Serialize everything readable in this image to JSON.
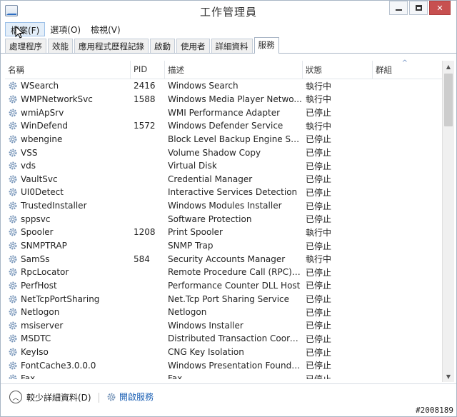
{
  "window": {
    "title": "工作管理員"
  },
  "menubar": {
    "items": [
      "檔案(F)",
      "選項(O)",
      "檢視(V)"
    ]
  },
  "tabs": [
    "處理程序",
    "效能",
    "應用程式歷程記錄",
    "啟動",
    "使用者",
    "詳細資料",
    "服務"
  ],
  "active_tab": 6,
  "table": {
    "columns": [
      "名稱",
      "PID",
      "描述",
      "狀態",
      "群組"
    ],
    "rows": [
      [
        "WSearch",
        "2416",
        "Windows Search",
        "執行中",
        ""
      ],
      [
        "WMPNetworkSvc",
        "1588",
        "Windows Media Player Netwo...",
        "執行中",
        ""
      ],
      [
        "wmiApSrv",
        "",
        "WMI Performance Adapter",
        "已停止",
        ""
      ],
      [
        "WinDefend",
        "1572",
        "Windows Defender Service",
        "執行中",
        ""
      ],
      [
        "wbengine",
        "",
        "Block Level Backup Engine Ser...",
        "已停止",
        ""
      ],
      [
        "VSS",
        "",
        "Volume Shadow Copy",
        "已停止",
        ""
      ],
      [
        "vds",
        "",
        "Virtual Disk",
        "已停止",
        ""
      ],
      [
        "VaultSvc",
        "",
        "Credential Manager",
        "已停止",
        ""
      ],
      [
        "UI0Detect",
        "",
        "Interactive Services Detection",
        "已停止",
        ""
      ],
      [
        "TrustedInstaller",
        "",
        "Windows Modules Installer",
        "已停止",
        ""
      ],
      [
        "sppsvc",
        "",
        "Software Protection",
        "已停止",
        ""
      ],
      [
        "Spooler",
        "1208",
        "Print Spooler",
        "執行中",
        ""
      ],
      [
        "SNMPTRAP",
        "",
        "SNMP Trap",
        "已停止",
        ""
      ],
      [
        "SamSs",
        "584",
        "Security Accounts Manager",
        "執行中",
        ""
      ],
      [
        "RpcLocator",
        "",
        "Remote Procedure Call (RPC) L...",
        "已停止",
        ""
      ],
      [
        "PerfHost",
        "",
        "Performance Counter DLL Host",
        "已停止",
        ""
      ],
      [
        "NetTcpPortSharing",
        "",
        "Net.Tcp Port Sharing Service",
        "已停止",
        ""
      ],
      [
        "Netlogon",
        "",
        "Netlogon",
        "已停止",
        ""
      ],
      [
        "msiserver",
        "",
        "Windows Installer",
        "已停止",
        ""
      ],
      [
        "MSDTC",
        "",
        "Distributed Transaction Coordi...",
        "已停止",
        ""
      ],
      [
        "KeyIso",
        "",
        "CNG Key Isolation",
        "已停止",
        ""
      ],
      [
        "FontCache3.0.0.0",
        "",
        "Windows Presentation Founda...",
        "已停止",
        ""
      ],
      [
        "Fax",
        "",
        "Fax",
        "已停止",
        ""
      ]
    ]
  },
  "footer": {
    "fewer_details": "較少詳細資料(D)",
    "open_services": "開啟服務"
  },
  "watermark": "#2008189",
  "colors": {
    "link": "#1a5fb4",
    "close": "#c75050",
    "gear": "#6f8fb5"
  }
}
